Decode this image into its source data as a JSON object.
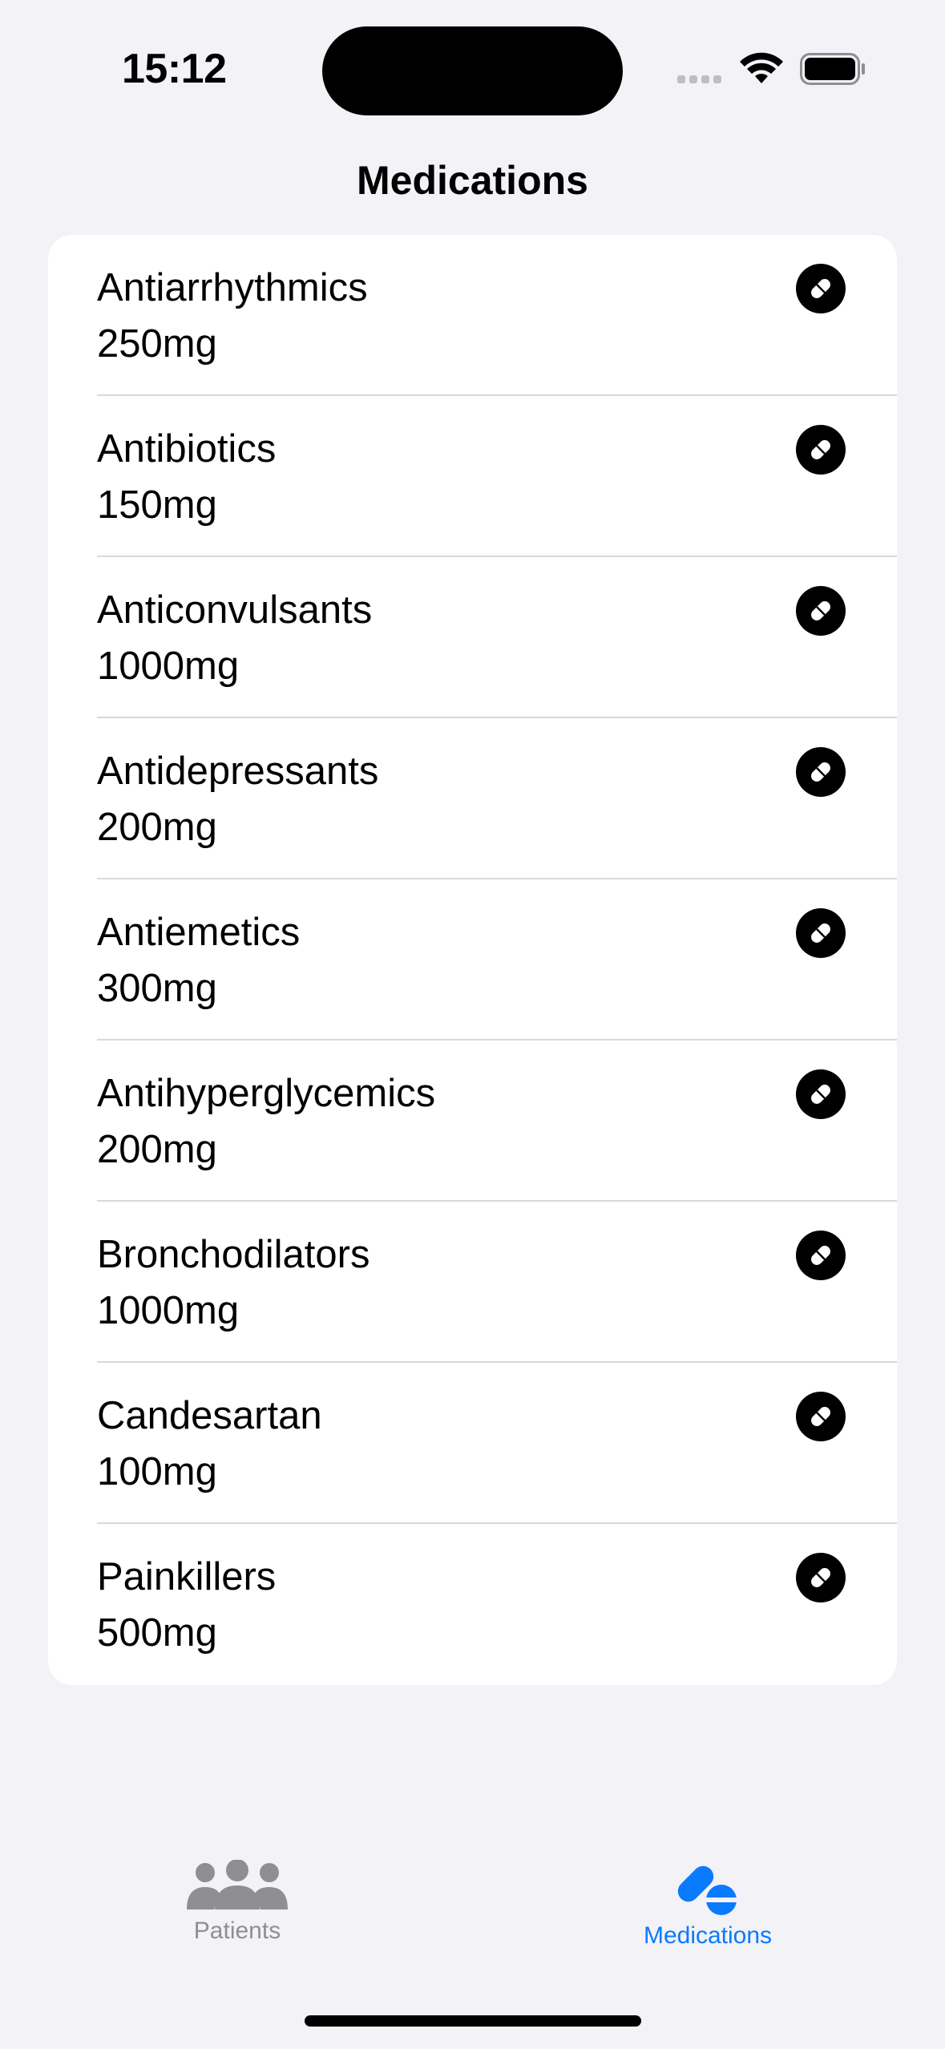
{
  "status_bar": {
    "time": "15:12"
  },
  "nav": {
    "title": "Medications"
  },
  "medications": [
    {
      "name": "Antiarrhythmics",
      "dose": "250mg"
    },
    {
      "name": "Antibiotics",
      "dose": "150mg"
    },
    {
      "name": "Anticonvulsants",
      "dose": "1000mg"
    },
    {
      "name": "Antidepressants",
      "dose": "200mg"
    },
    {
      "name": "Antiemetics",
      "dose": "300mg"
    },
    {
      "name": "Antihyperglycemics",
      "dose": "200mg"
    },
    {
      "name": "Bronchodilators",
      "dose": "1000mg"
    },
    {
      "name": "Candesartan",
      "dose": "100mg"
    },
    {
      "name": "Painkillers",
      "dose": "500mg"
    }
  ],
  "row_icon": "pill-icon",
  "tabbar": {
    "tabs": [
      {
        "label": "Patients",
        "icon": "people-icon",
        "selected": false
      },
      {
        "label": "Medications",
        "icon": "pills-icon",
        "selected": true
      }
    ]
  },
  "colors": {
    "accent": "#0a7aff",
    "inactive": "#8e8e93",
    "background": "#f2f2f7"
  }
}
